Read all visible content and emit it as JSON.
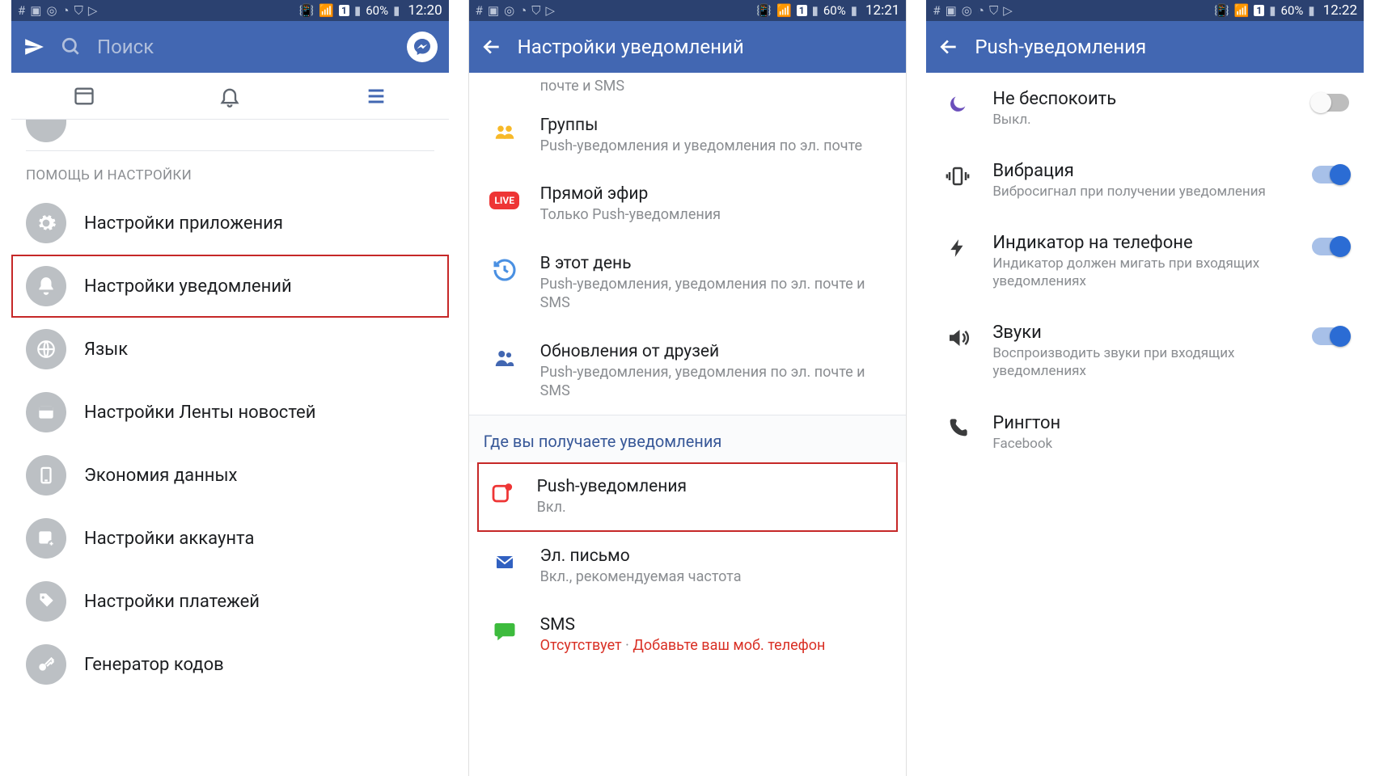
{
  "statusbar": {
    "battery": "60%",
    "t1": "12:20",
    "t2": "12:21",
    "t3": "12:22",
    "sim": "1"
  },
  "s1": {
    "search_placeholder": "Поиск",
    "section": "ПОМОЩЬ И НАСТРОЙКИ",
    "items": {
      "app": "Настройки приложения",
      "notif": "Настройки уведомлений",
      "lang": "Язык",
      "feed": "Настройки Ленты новостей",
      "data": "Экономия данных",
      "account": "Настройки аккаунта",
      "pay": "Настройки платежей",
      "codes": "Генератор кодов"
    }
  },
  "s2": {
    "title": "Настройки уведомлений",
    "truncated_sub": "почте и SMS",
    "groups": {
      "t": "Группы",
      "s": "Push-уведомления и уведомления по эл. почте"
    },
    "live": {
      "t": "Прямой эфир",
      "s": "Только Push-уведомления"
    },
    "onthisday": {
      "t": "В этот день",
      "s": "Push-уведомления, уведомления по эл. почте и SMS"
    },
    "friends": {
      "t": "Обновления от друзей",
      "s": "Push-уведомления, уведомления по эл. почте и SMS"
    },
    "where_h": "Где вы получаете уведомления",
    "push": {
      "t": "Push-уведомления",
      "s": "Вкл."
    },
    "email": {
      "t": "Эл. письмо",
      "s": "Вкл., рекомендуемая частота"
    },
    "sms": {
      "t": "SMS",
      "warn": "Отсутствует",
      "dot": " · ",
      "cta": "Добавьте ваш моб. телефон"
    }
  },
  "s3": {
    "title": "Push-уведомления",
    "dnd": {
      "t": "Не беспокоить",
      "s": "Выкл.",
      "on": false
    },
    "vib": {
      "t": "Вибрация",
      "s": "Вибросигнал при получении уведомления",
      "on": true
    },
    "led": {
      "t": "Индикатор на телефоне",
      "s": "Индикатор должен мигать при входящих уведомлениях",
      "on": true
    },
    "snd": {
      "t": "Звуки",
      "s": "Воспроизводить звуки при входящих уведомлениях",
      "on": true
    },
    "ring": {
      "t": "Рингтон",
      "s": "Facebook"
    }
  }
}
